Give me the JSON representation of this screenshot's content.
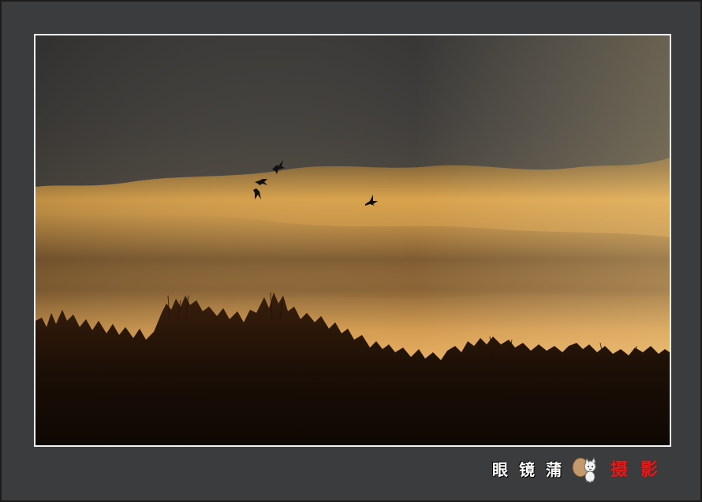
{
  "photo": {
    "subject": "geese-silhouettes-over-treeline-at-sunset",
    "palette": {
      "cloud_dark": "#3d3d3c",
      "sky_gold": "#d9a04c",
      "sky_glow": "#f0b861",
      "tree_silhouette": "#1a0f08",
      "frame_bg": "#3b3c3e",
      "frame_border": "#f2f2f2"
    },
    "birds_visible": 4
  },
  "signature": {
    "name_chars": [
      "眼",
      "镜",
      "蒲"
    ],
    "mark_icon": "cat-mascot-icon",
    "label_chars": [
      "摄",
      "影"
    ],
    "label_color": "#e21b1b"
  }
}
